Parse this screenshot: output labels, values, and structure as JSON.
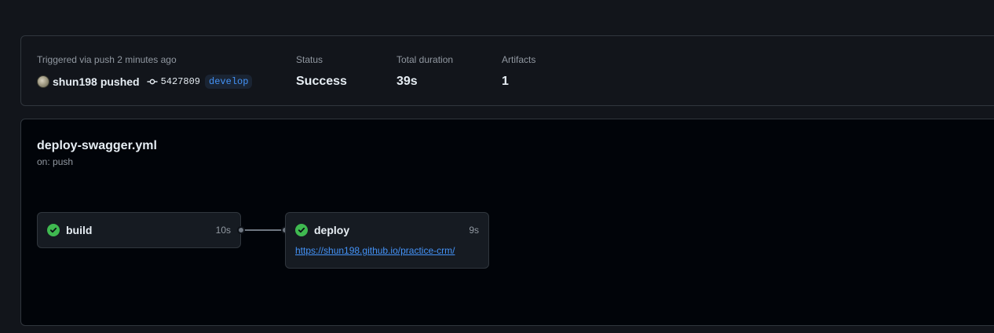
{
  "summary": {
    "trigger_label": "Triggered via push 2 minutes ago",
    "actor": "shun198",
    "action": "pushed",
    "commit_sha": "5427809",
    "branch": "develop",
    "status_label": "Status",
    "status_value": "Success",
    "duration_label": "Total duration",
    "duration_value": "39s",
    "artifacts_label": "Artifacts",
    "artifacts_value": "1"
  },
  "workflow": {
    "file": "deploy-swagger.yml",
    "trigger": "on: push",
    "jobs": [
      {
        "name": "build",
        "duration": "10s",
        "status": "success"
      },
      {
        "name": "deploy",
        "duration": "9s",
        "status": "success",
        "link": "https://shun198.github.io/practice-crm/"
      }
    ]
  },
  "colors": {
    "success": "#3fb950",
    "link": "#4493f8",
    "background": "#12151b",
    "panel": "#010409",
    "border": "#30363d"
  },
  "icons": {
    "commit": "git-commit-icon",
    "check": "check-circle-fill-icon"
  }
}
